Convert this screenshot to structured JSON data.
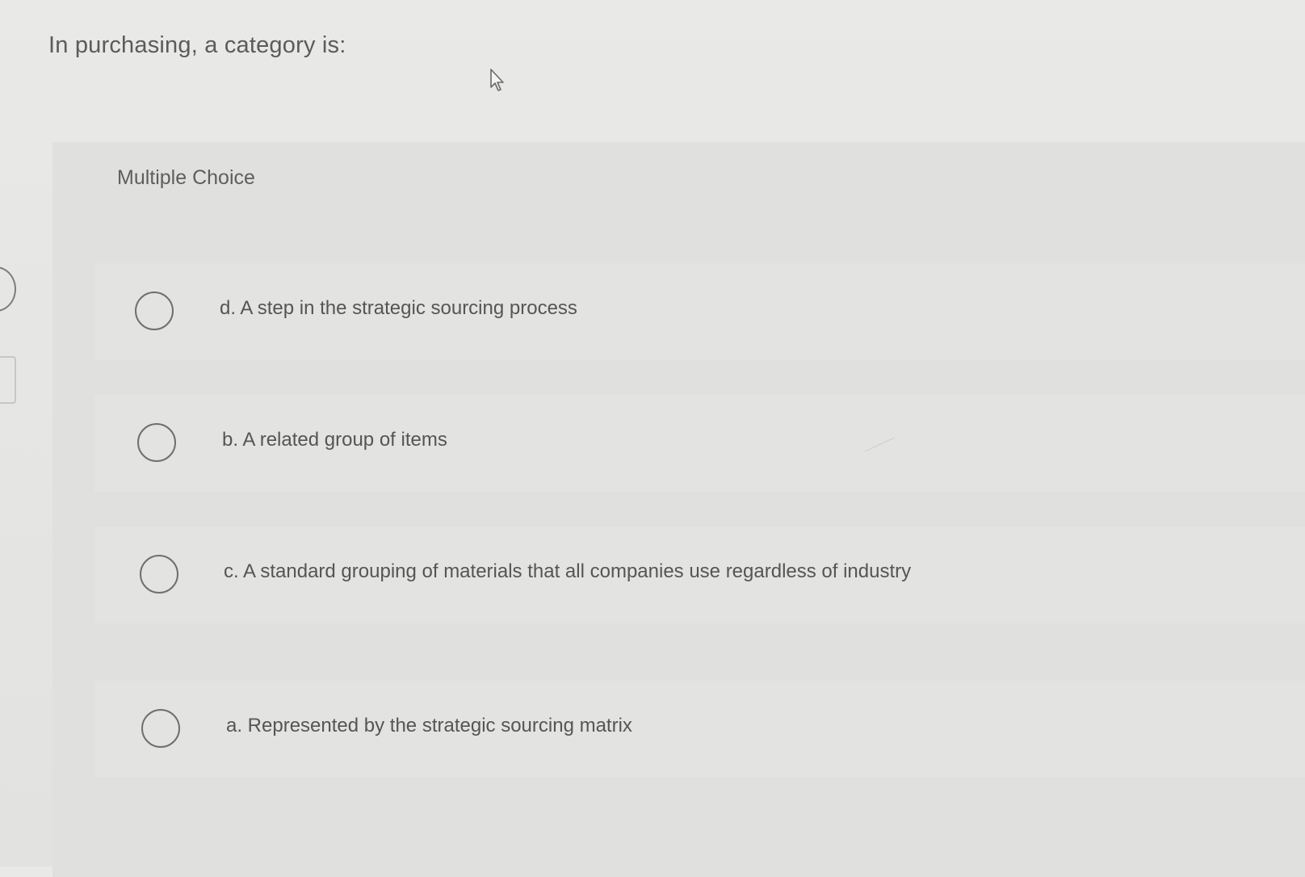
{
  "question": {
    "title": "In purchasing, a category is:"
  },
  "card": {
    "label": "Multiple Choice"
  },
  "choices": [
    {
      "text": "d. A step in the strategic sourcing process"
    },
    {
      "text": "b. A related group of items"
    },
    {
      "text": "c. A standard grouping of materials that all companies use regardless of industry"
    },
    {
      "text": "a. Represented by the strategic sourcing matrix"
    }
  ],
  "icons": {
    "cursor": "mouse-pointer-icon",
    "radio": "radio-button-icon"
  },
  "colors": {
    "background": "#e7e7e5",
    "card": "#e0e0de",
    "text": "#5a5a5a",
    "radio_border": "#6f6f6f"
  }
}
